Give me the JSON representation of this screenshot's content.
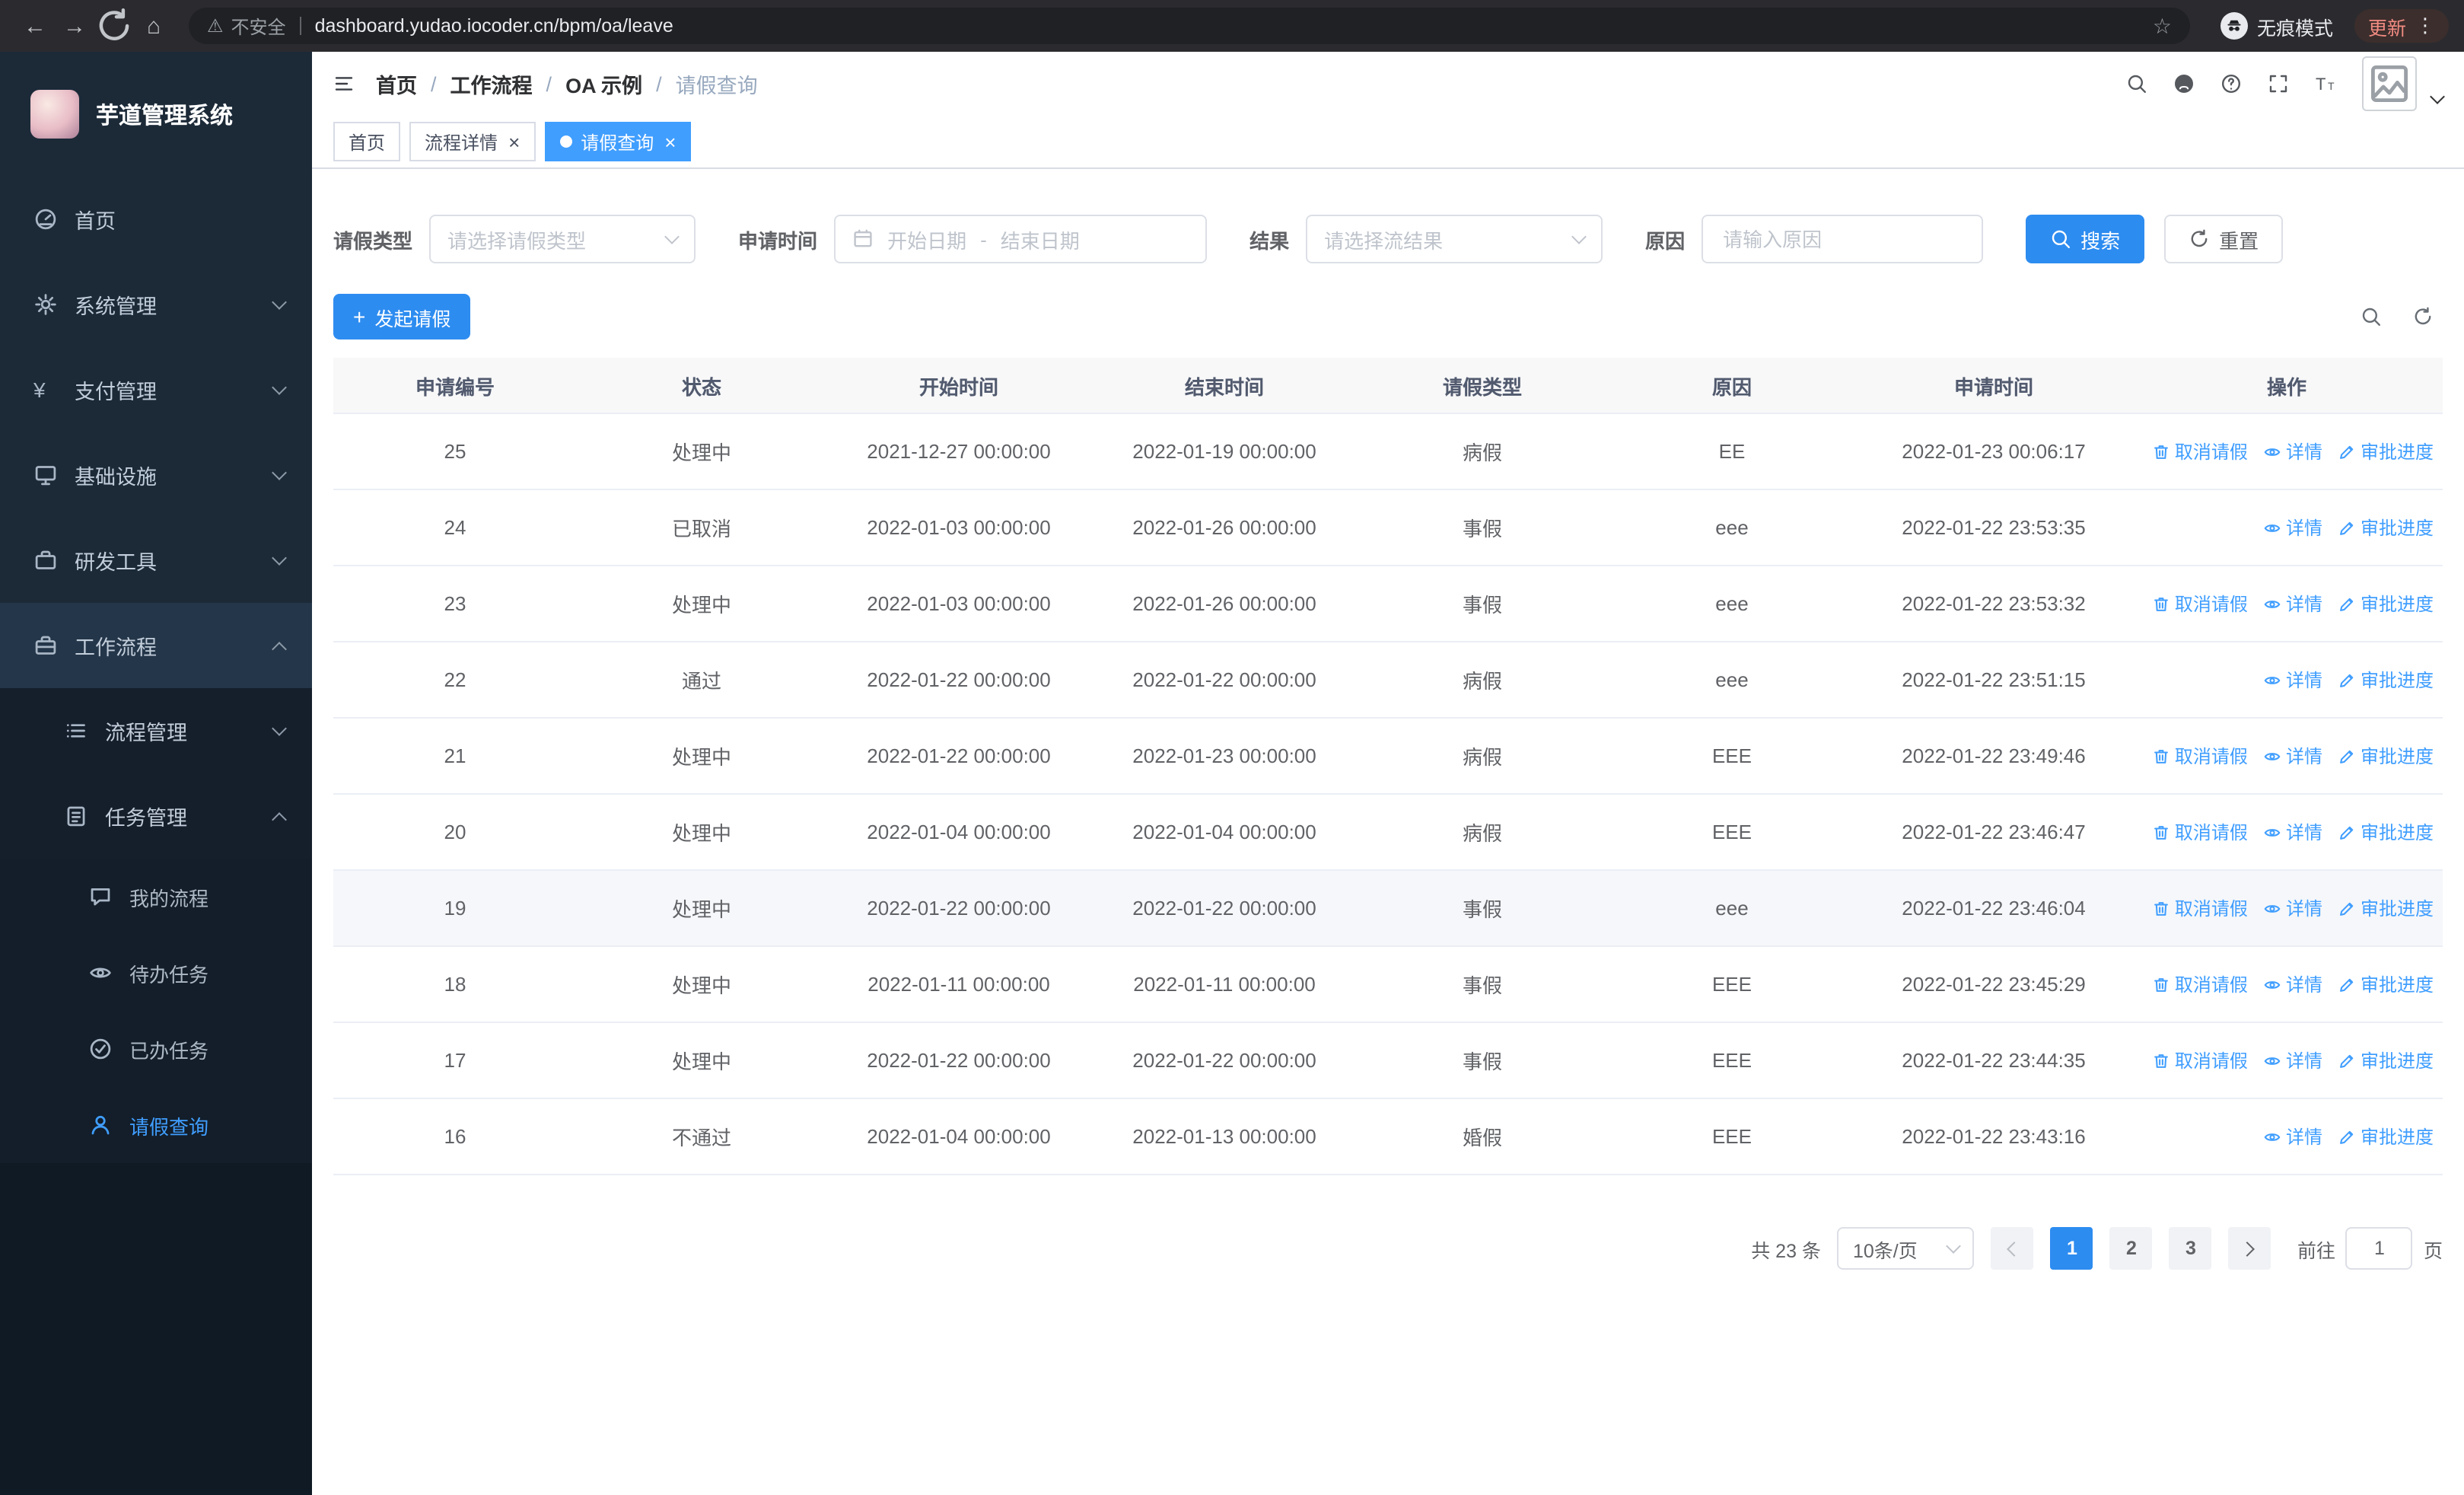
{
  "browser": {
    "security_label": "不安全",
    "url": "dashboard.yudao.iocoder.cn/bpm/oa/leave",
    "incognito_label": "无痕模式",
    "update_label": "更新"
  },
  "sidebar": {
    "app_title": "芋道管理系统",
    "menu": [
      {
        "name": "home",
        "label": "首页",
        "icon": "dashboard-icon",
        "level": 1
      },
      {
        "name": "system-management",
        "label": "系统管理",
        "icon": "gear-icon",
        "level": 1,
        "chevron": "down"
      },
      {
        "name": "payment-management",
        "label": "支付管理",
        "icon": "yen-icon",
        "level": 1,
        "chevron": "down"
      },
      {
        "name": "infrastructure",
        "label": "基础设施",
        "icon": "monitor-icon",
        "level": 1,
        "chevron": "down"
      },
      {
        "name": "dev-tools",
        "label": "研发工具",
        "icon": "toolbox-icon",
        "level": 1,
        "chevron": "down"
      },
      {
        "name": "workflow",
        "label": "工作流程",
        "icon": "briefcase-icon",
        "level": 1,
        "chevron": "up",
        "open": true
      },
      {
        "name": "process-management",
        "label": "流程管理",
        "icon": "list-icon",
        "level": 2,
        "chevron": "down"
      },
      {
        "name": "task-management",
        "label": "任务管理",
        "icon": "tasks-icon",
        "level": 2,
        "chevron": "up",
        "open": true
      },
      {
        "name": "my-processes",
        "label": "我的流程",
        "icon": "chat-icon",
        "level": 3
      },
      {
        "name": "todo-tasks",
        "label": "待办任务",
        "icon": "eye-icon",
        "level": 3
      },
      {
        "name": "done-tasks",
        "label": "已办任务",
        "icon": "done-icon",
        "level": 3
      },
      {
        "name": "leave-query",
        "label": "请假查询",
        "icon": "user-icon",
        "level": 3,
        "active": true
      }
    ]
  },
  "header": {
    "breadcrumb": [
      "首页",
      "工作流程",
      "OA 示例",
      "请假查询"
    ]
  },
  "tabs": [
    {
      "name": "home",
      "label": "首页",
      "closable": false,
      "active": false
    },
    {
      "name": "process-detail",
      "label": "流程详情",
      "closable": true,
      "active": false
    },
    {
      "name": "leave-query",
      "label": "请假查询",
      "closable": true,
      "active": true
    }
  ],
  "filters": {
    "leave_type": {
      "label": "请假类型",
      "placeholder": "请选择请假类型"
    },
    "apply_time": {
      "label": "申请时间",
      "start_placeholder": "开始日期",
      "separator": "-",
      "end_placeholder": "结束日期"
    },
    "result": {
      "label": "结果",
      "placeholder": "请选择流结果"
    },
    "reason": {
      "label": "原因",
      "placeholder": "请输入原因"
    },
    "search_label": "搜索",
    "reset_label": "重置"
  },
  "toolbar": {
    "create_label": "发起请假"
  },
  "table": {
    "columns": [
      "申请编号",
      "状态",
      "开始时间",
      "结束时间",
      "请假类型",
      "原因",
      "申请时间",
      "操作"
    ],
    "action_labels": {
      "cancel": "取消请假",
      "detail": "详情",
      "progress": "审批进度"
    },
    "action_icons": {
      "cancel": "trash-icon",
      "detail": "view-icon",
      "progress": "edit-icon"
    },
    "rows": [
      {
        "id": "25",
        "status": "处理中",
        "start": "2021-12-27 00:00:00",
        "end": "2022-01-19 00:00:00",
        "type": "病假",
        "reason": "EE",
        "applied": "2022-01-23 00:06:17",
        "actions": [
          "cancel",
          "detail",
          "progress"
        ],
        "highlight": false
      },
      {
        "id": "24",
        "status": "已取消",
        "start": "2022-01-03 00:00:00",
        "end": "2022-01-26 00:00:00",
        "type": "事假",
        "reason": "eee",
        "applied": "2022-01-22 23:53:35",
        "actions": [
          "detail",
          "progress"
        ],
        "highlight": false
      },
      {
        "id": "23",
        "status": "处理中",
        "start": "2022-01-03 00:00:00",
        "end": "2022-01-26 00:00:00",
        "type": "事假",
        "reason": "eee",
        "applied": "2022-01-22 23:53:32",
        "actions": [
          "cancel",
          "detail",
          "progress"
        ],
        "highlight": false
      },
      {
        "id": "22",
        "status": "通过",
        "start": "2022-01-22 00:00:00",
        "end": "2022-01-22 00:00:00",
        "type": "病假",
        "reason": "eee",
        "applied": "2022-01-22 23:51:15",
        "actions": [
          "detail",
          "progress"
        ],
        "highlight": false
      },
      {
        "id": "21",
        "status": "处理中",
        "start": "2022-01-22 00:00:00",
        "end": "2022-01-23 00:00:00",
        "type": "病假",
        "reason": "EEE",
        "applied": "2022-01-22 23:49:46",
        "actions": [
          "cancel",
          "detail",
          "progress"
        ],
        "highlight": false
      },
      {
        "id": "20",
        "status": "处理中",
        "start": "2022-01-04 00:00:00",
        "end": "2022-01-04 00:00:00",
        "type": "病假",
        "reason": "EEE",
        "applied": "2022-01-22 23:46:47",
        "actions": [
          "cancel",
          "detail",
          "progress"
        ],
        "highlight": false
      },
      {
        "id": "19",
        "status": "处理中",
        "start": "2022-01-22 00:00:00",
        "end": "2022-01-22 00:00:00",
        "type": "事假",
        "reason": "eee",
        "applied": "2022-01-22 23:46:04",
        "actions": [
          "cancel",
          "detail",
          "progress"
        ],
        "highlight": true
      },
      {
        "id": "18",
        "status": "处理中",
        "start": "2022-01-11 00:00:00",
        "end": "2022-01-11 00:00:00",
        "type": "事假",
        "reason": "EEE",
        "applied": "2022-01-22 23:45:29",
        "actions": [
          "cancel",
          "detail",
          "progress"
        ],
        "highlight": false
      },
      {
        "id": "17",
        "status": "处理中",
        "start": "2022-01-22 00:00:00",
        "end": "2022-01-22 00:00:00",
        "type": "事假",
        "reason": "EEE",
        "applied": "2022-01-22 23:44:35",
        "actions": [
          "cancel",
          "detail",
          "progress"
        ],
        "highlight": false
      },
      {
        "id": "16",
        "status": "不通过",
        "start": "2022-01-04 00:00:00",
        "end": "2022-01-13 00:00:00",
        "type": "婚假",
        "reason": "EEE",
        "applied": "2022-01-22 23:43:16",
        "actions": [
          "detail",
          "progress"
        ],
        "highlight": false
      }
    ]
  },
  "pagination": {
    "total_label": "共 23 条",
    "page_size": "10条/页",
    "pages": [
      "1",
      "2",
      "3"
    ],
    "current": "1",
    "goto_prefix": "前往",
    "goto_value": "1",
    "goto_suffix": "页"
  }
}
